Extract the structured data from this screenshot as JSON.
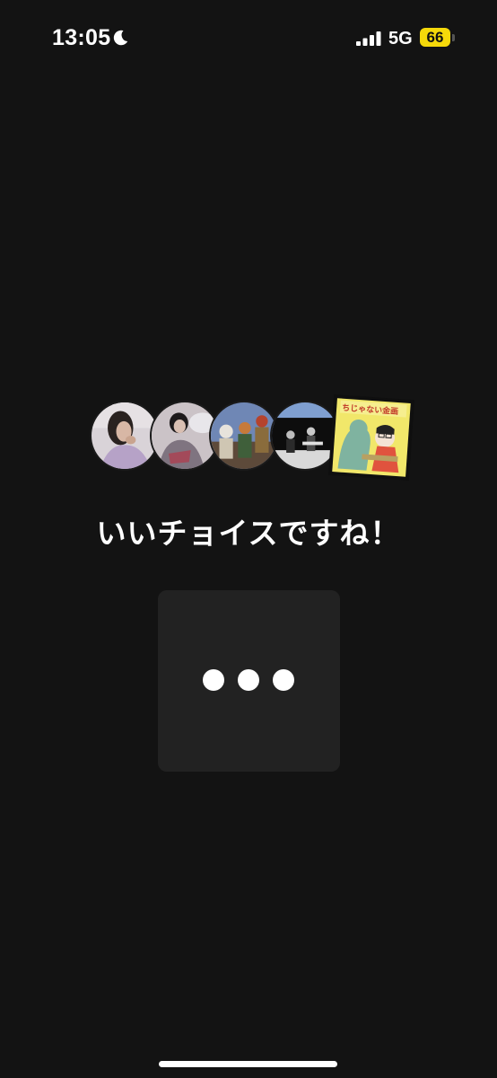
{
  "status_bar": {
    "time": "13:05",
    "moon_icon": "moon-icon",
    "signal_icon": "cellular-signal-icon",
    "network": "5G",
    "battery_level": "66",
    "battery_color": "#f5d90a"
  },
  "avatars": [
    {
      "icon": "artist-avatar-1"
    },
    {
      "icon": "artist-avatar-2"
    },
    {
      "icon": "artist-avatar-3"
    },
    {
      "icon": "artist-avatar-4"
    },
    {
      "icon": "book-cover-thumbnail"
    }
  ],
  "main": {
    "heading": "いいチョイスですね！"
  },
  "loading": {
    "icon": "ellipsis-loading-icon",
    "card_color": "#222222"
  },
  "theme": {
    "background": "#131313",
    "text": "#ffffff"
  }
}
